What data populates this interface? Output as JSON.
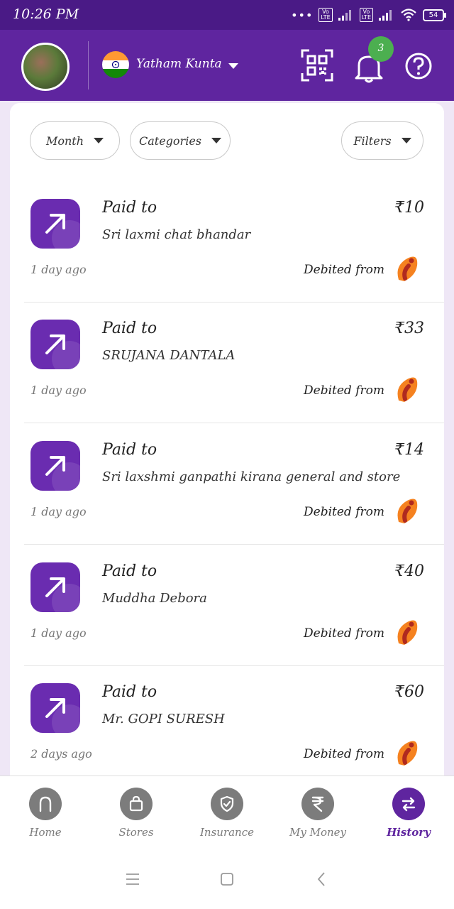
{
  "status_bar": {
    "time": "10:26 PM",
    "battery": "54",
    "volte_label": "Vo LTE"
  },
  "header": {
    "user_name": "Yatham Kunta",
    "notification_count": "3",
    "colors": {
      "brand": "#5f259f",
      "status_bar": "#4a1a86",
      "badge": "#4caf50"
    }
  },
  "filters": {
    "month": "Month",
    "categories": "Categories",
    "filters": "Filters"
  },
  "transactions": [
    {
      "label": "Paid to",
      "payee": "Sri laxmi chat bhandar",
      "amount": "₹10",
      "time": "1 day ago",
      "debited": "Debited from"
    },
    {
      "label": "Paid to",
      "payee": "SRUJANA DANTALA",
      "amount": "₹33",
      "time": "1 day ago",
      "debited": "Debited from"
    },
    {
      "label": "Paid to",
      "payee": "Sri laxshmi ganpathi kirana general and store",
      "amount": "₹14",
      "time": "1 day ago",
      "debited": "Debited from"
    },
    {
      "label": "Paid to",
      "payee": "Muddha Debora",
      "amount": "₹40",
      "time": "1 day ago",
      "debited": "Debited from"
    },
    {
      "label": "Paid to",
      "payee": "Mr. GOPI  SURESH",
      "amount": "₹60",
      "time": "2 days ago",
      "debited": "Debited from"
    }
  ],
  "bottom_nav": [
    {
      "label": "Home",
      "icon": "home-icon"
    },
    {
      "label": "Stores",
      "icon": "bag-icon"
    },
    {
      "label": "Insurance",
      "icon": "shield-icon"
    },
    {
      "label": "My Money",
      "icon": "rupee-icon"
    },
    {
      "label": "History",
      "icon": "swap-arrows-icon",
      "active": true
    }
  ]
}
